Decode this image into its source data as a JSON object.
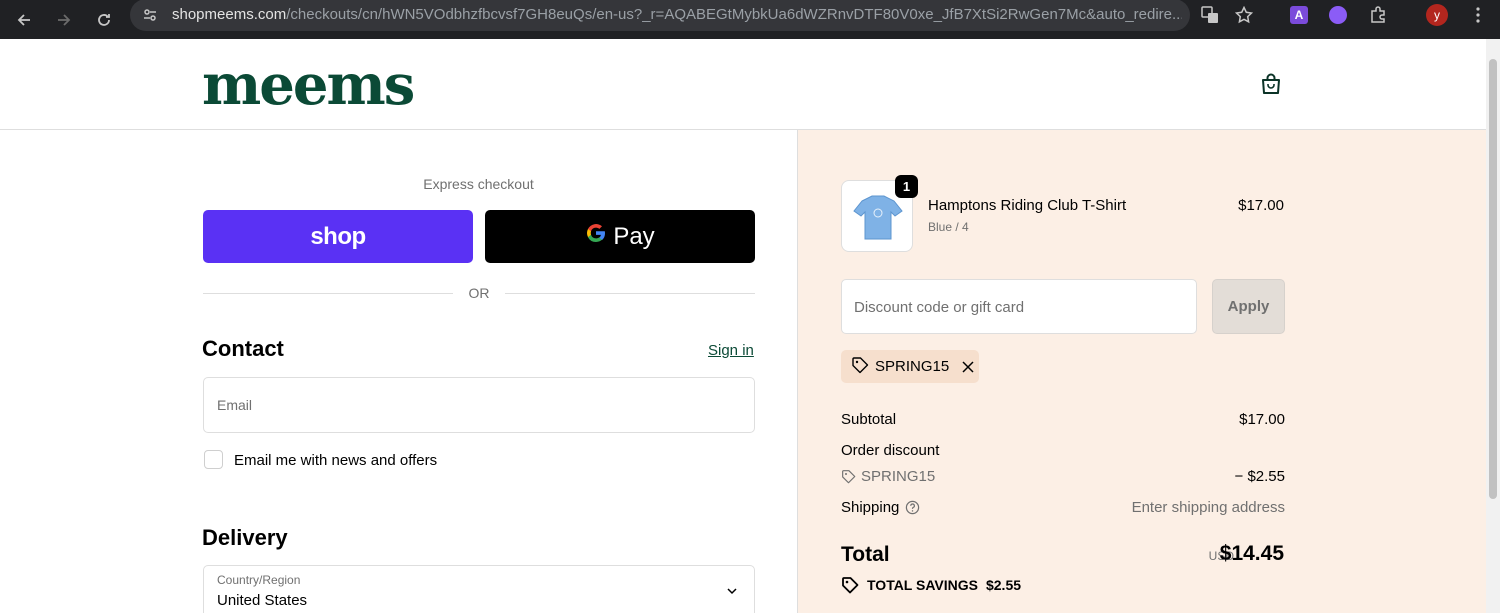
{
  "browser": {
    "url_host": "shopmeems.com",
    "url_path": "/checkouts/cn/hWN5VOdbhzfbcvsf7GH8euQs/en-us?_r=AQABEGtMybkUa6dWZRnvDTF80V0xe_JfB7XtSi2RwGen7Mc&auto_redire..."
  },
  "header": {
    "logo": "meems"
  },
  "express": {
    "label": "Express checkout",
    "shop_label": "shop",
    "gpay_label": "Pay",
    "or": "OR"
  },
  "contact": {
    "title": "Contact",
    "signin": "Sign in",
    "email_placeholder": "Email",
    "newsletter_label": "Email me with news and offers"
  },
  "delivery": {
    "title": "Delivery",
    "country_label": "Country/Region",
    "country_value": "United States"
  },
  "summary": {
    "item": {
      "name": "Hamptons Riding Club T-Shirt",
      "variant": "Blue / 4",
      "price": "$17.00",
      "quantity": "1"
    },
    "discount_placeholder": "Discount code or gift card",
    "apply_label": "Apply",
    "applied_code": "SPRING15",
    "subtotal_label": "Subtotal",
    "subtotal_value": "$17.00",
    "order_discount_label": "Order discount",
    "discount_code": "SPRING15",
    "discount_value": "− $2.55",
    "shipping_label": "Shipping",
    "shipping_value": "Enter shipping address",
    "total_label": "Total",
    "currency": "USD",
    "total_value": "$14.45",
    "savings_label": "TOTAL SAVINGS",
    "savings_value": "$2.55"
  }
}
